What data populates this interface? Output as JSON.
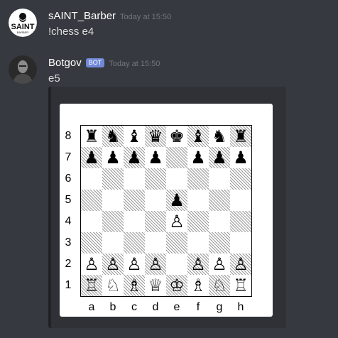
{
  "messages": [
    {
      "username": "sAINT_Barber",
      "timestamp": "Today at 15:50",
      "text": "!chess e4",
      "avatar_text": "SAINT",
      "avatar_subtext": "BARBER"
    },
    {
      "username": "Botgov",
      "bot_tag": "BOT",
      "timestamp": "Today at 15:50",
      "text": "e5"
    }
  ],
  "chessboard": {
    "ranks": [
      "8",
      "7",
      "6",
      "5",
      "4",
      "3",
      "2",
      "1"
    ],
    "files": [
      "a",
      "b",
      "c",
      "d",
      "e",
      "f",
      "g",
      "h"
    ],
    "rows": [
      [
        "♜",
        "♞",
        "♝",
        "♛",
        "♚",
        "♝",
        "♞",
        "♜"
      ],
      [
        "♟",
        "♟",
        "♟",
        "♟",
        "",
        "♟",
        "♟",
        "♟"
      ],
      [
        "",
        "",
        "",
        "",
        "",
        "",
        "",
        ""
      ],
      [
        "",
        "",
        "",
        "",
        "♟",
        "",
        "",
        ""
      ],
      [
        "",
        "",
        "",
        "",
        "♙",
        "",
        "",
        ""
      ],
      [
        "",
        "",
        "",
        "",
        "",
        "",
        "",
        ""
      ],
      [
        "♙",
        "♙",
        "♙",
        "♙",
        "",
        "♙",
        "♙",
        "♙"
      ],
      [
        "♖",
        "♘",
        "♗",
        "♕",
        "♔",
        "♗",
        "♘",
        "♖"
      ]
    ]
  },
  "colors": {
    "background": "#36393f",
    "embed": "#2f3136",
    "bot_tag": "#7289da",
    "timestamp": "#72767d"
  }
}
